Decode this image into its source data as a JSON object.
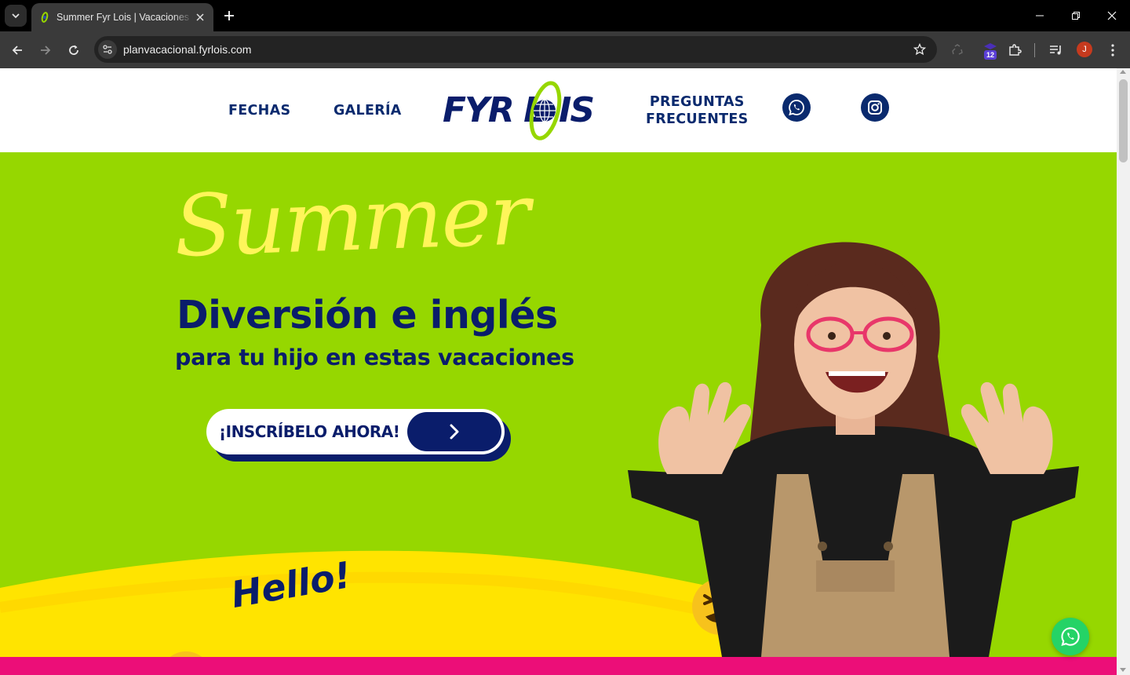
{
  "browser": {
    "tab_title": "Summer Fyr Lois | Vacaciones en inglés",
    "url": "planvacacional.fyrlois.com",
    "extension_badge_count": "12",
    "profile_initial": "J"
  },
  "nav": {
    "fechas": "FECHAS",
    "galeria": "GALERÍA",
    "preguntas_line1": "PREGUNTAS",
    "preguntas_line2": "FRECUENTES",
    "logo_text": "FYR LOIS"
  },
  "hero": {
    "script_title": "Summer",
    "headline": "Diversión e inglés",
    "subline": "para tu hijo en estas vacaciones",
    "cta_label": "¡INSCRÍBELO AHORA!",
    "hello": "Hello!"
  },
  "colors": {
    "brand_navy": "#0a1d6b",
    "hero_green": "#96d700",
    "accent_yellow": "#fff55a",
    "band_pink": "#ec0e78",
    "whatsapp_green": "#25d366"
  },
  "icons": {
    "whatsapp": "whatsapp-icon",
    "instagram": "instagram-icon",
    "chevron": "chevron-right-icon"
  }
}
